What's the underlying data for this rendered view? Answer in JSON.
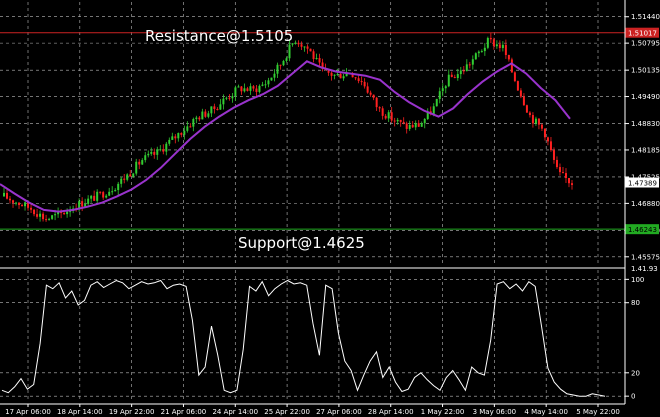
{
  "chart_data": [
    {
      "type": "candlestick",
      "background": "#000000",
      "grid": true,
      "bull_color": "#32cd32",
      "bear_color": "#ff2020",
      "x_tick_labels": [
        "17 Apr 06:00",
        "18 Apr 14:00",
        "19 Apr 22:00",
        "21 Apr 06:00",
        "24 Apr 14:00",
        "25 Apr 22:00",
        "27 Apr 06:00",
        "28 Apr 14:00",
        "1 May 22:00",
        "3 May 06:00",
        "4 May 14:00",
        "5 May 22:00"
      ],
      "y_tick_labels": [
        "1.51440",
        "1.50795",
        "1.50135",
        "1.49490",
        "1.48830",
        "1.48185",
        "1.47525",
        "1.46880",
        "1.46220",
        "1.45575"
      ],
      "ylim": [
        1.4535,
        1.518
      ],
      "price_path": [
        1.4705,
        1.469,
        1.4675,
        1.465,
        1.466,
        1.468,
        1.4695,
        1.471,
        1.473,
        1.476,
        1.4795,
        1.481,
        1.484,
        1.487,
        1.49,
        1.4915,
        1.4945,
        1.497,
        1.4965,
        1.4985,
        1.503,
        1.509,
        1.5065,
        1.501,
        1.5,
        1.501,
        1.498,
        1.492,
        1.4895,
        1.4875,
        1.488,
        1.492,
        1.499,
        1.501,
        1.5045,
        1.5085,
        1.507,
        1.498,
        1.49,
        1.4865,
        1.476,
        1.4739
      ],
      "moving_average": {
        "color": "#9933cc",
        "values": [
          1.4735,
          1.4712,
          1.469,
          1.4672,
          1.4668,
          1.4672,
          1.468,
          1.469,
          1.4705,
          1.4722,
          1.4745,
          1.4775,
          1.481,
          1.4845,
          1.4875,
          1.49,
          1.4922,
          1.494,
          1.4955,
          1.4975,
          1.5005,
          1.5035,
          1.502,
          1.501,
          1.5005,
          1.5,
          1.499,
          1.496,
          1.4935,
          1.4915,
          1.49,
          1.492,
          1.4955,
          1.4985,
          1.501,
          1.503,
          1.5005,
          1.497,
          1.494,
          1.4895
        ]
      },
      "horizontal_lines": [
        {
          "name": "resistance",
          "value": 1.5105,
          "color": "#cc2222",
          "tag": "1.51017",
          "annotation": "Resistance@1.5105"
        },
        {
          "name": "support",
          "value": 1.4625,
          "color": "#22aa22",
          "tag": "1.46243",
          "annotation": "Support@1.4625"
        }
      ],
      "current_price": {
        "value": 1.4739,
        "tag": "1.47389"
      }
    },
    {
      "type": "line",
      "name": "oscillator",
      "color": "#ffffff",
      "ylim": [
        -5,
        108
      ],
      "y_tick_labels": [
        "100",
        "80",
        "20",
        "0"
      ],
      "levels": [
        100,
        80,
        20,
        0
      ],
      "header_label": "1.41.93",
      "values": [
        5,
        3,
        8,
        15,
        6,
        10,
        45,
        95,
        92,
        97,
        84,
        90,
        78,
        82,
        95,
        98,
        93,
        96,
        99,
        97,
        92,
        95,
        98,
        96,
        97,
        99,
        92,
        95,
        96,
        94,
        65,
        18,
        25,
        60,
        35,
        5,
        3,
        5,
        40,
        94,
        90,
        98,
        86,
        92,
        96,
        99,
        96,
        97,
        95,
        62,
        35,
        95,
        92,
        54,
        30,
        22,
        5,
        18,
        30,
        38,
        16,
        25,
        12,
        4,
        6,
        16,
        20,
        14,
        9,
        5,
        16,
        22,
        14,
        5,
        25,
        20,
        18,
        48,
        96,
        98,
        92,
        96,
        90,
        98,
        94,
        60,
        24,
        12,
        6,
        2,
        1,
        0,
        0,
        2,
        1,
        0
      ]
    }
  ]
}
